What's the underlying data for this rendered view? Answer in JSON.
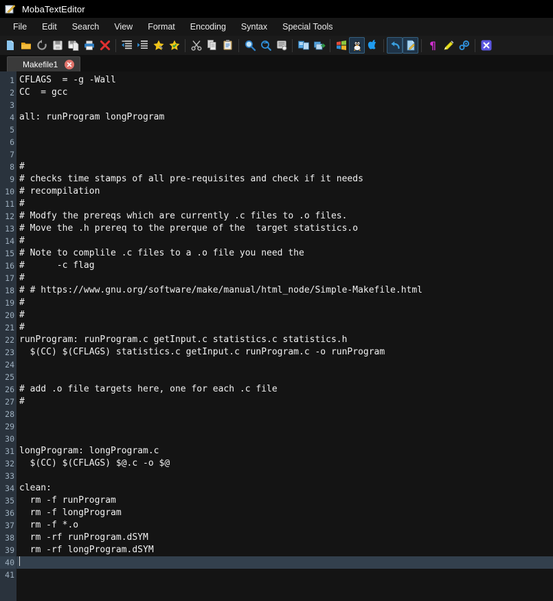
{
  "window": {
    "title": "MobaTextEditor",
    "icon": "notepad-pencil-icon"
  },
  "menubar": {
    "items": [
      {
        "label": "File",
        "name": "menu-file"
      },
      {
        "label": "Edit",
        "name": "menu-edit"
      },
      {
        "label": "Search",
        "name": "menu-search"
      },
      {
        "label": "View",
        "name": "menu-view"
      },
      {
        "label": "Format",
        "name": "menu-format"
      },
      {
        "label": "Encoding",
        "name": "menu-encoding"
      },
      {
        "label": "Syntax",
        "name": "menu-syntax"
      },
      {
        "label": "Special Tools",
        "name": "menu-special-tools"
      }
    ]
  },
  "toolbar": {
    "buttons": [
      {
        "icon": "new-file-icon",
        "title": "New",
        "active": false
      },
      {
        "icon": "open-folder-icon",
        "title": "Open",
        "active": false
      },
      {
        "icon": "reload-icon",
        "title": "Reload",
        "active": false
      },
      {
        "icon": "save-icon",
        "title": "Save",
        "active": false
      },
      {
        "icon": "save-as-icon",
        "title": "Save As",
        "active": false
      },
      {
        "icon": "print-icon",
        "title": "Print",
        "active": false
      },
      {
        "icon": "close-file-icon",
        "title": "Close",
        "active": false
      },
      {
        "icon": "separator",
        "title": "",
        "active": false
      },
      {
        "icon": "unindent-icon",
        "title": "Unindent",
        "active": false
      },
      {
        "icon": "indent-icon",
        "title": "Indent",
        "active": false
      },
      {
        "icon": "bookmark-toggle-icon",
        "title": "Toggle Bookmark",
        "active": false
      },
      {
        "icon": "bookmark-next-icon",
        "title": "Next Bookmark",
        "active": false
      },
      {
        "icon": "separator",
        "title": "",
        "active": false
      },
      {
        "icon": "cut-icon",
        "title": "Cut",
        "active": false
      },
      {
        "icon": "copy-icon",
        "title": "Copy",
        "active": false
      },
      {
        "icon": "paste-icon",
        "title": "Paste",
        "active": false
      },
      {
        "icon": "separator",
        "title": "",
        "active": false
      },
      {
        "icon": "find-icon",
        "title": "Find",
        "active": false
      },
      {
        "icon": "find-replace-icon",
        "title": "Find and Replace",
        "active": false
      },
      {
        "icon": "goto-line-icon",
        "title": "Go To Line",
        "active": false
      },
      {
        "icon": "separator",
        "title": "",
        "active": false
      },
      {
        "icon": "compare-files-icon",
        "title": "Compare",
        "active": false
      },
      {
        "icon": "send-to-icon",
        "title": "Send To",
        "active": false
      },
      {
        "icon": "separator",
        "title": "",
        "active": false
      },
      {
        "icon": "windows-format-icon",
        "title": "Windows Format",
        "active": false
      },
      {
        "icon": "linux-format-icon",
        "title": "Unix Format",
        "active": true
      },
      {
        "icon": "apple-format-icon",
        "title": "Mac Format",
        "active": false
      },
      {
        "icon": "separator",
        "title": "",
        "active": false
      },
      {
        "icon": "undo-icon",
        "title": "Undo",
        "active": true
      },
      {
        "icon": "redo-edit-icon",
        "title": "Redo",
        "active": true
      },
      {
        "icon": "separator",
        "title": "",
        "active": false
      },
      {
        "icon": "pilcrow-icon",
        "title": "Show Formatting",
        "active": false
      },
      {
        "icon": "highlighter-icon",
        "title": "Highlight",
        "active": false
      },
      {
        "icon": "settings-gear-icon",
        "title": "Settings",
        "active": false
      },
      {
        "icon": "separator",
        "title": "",
        "active": false
      },
      {
        "icon": "exit-icon",
        "title": "Exit",
        "active": false
      }
    ]
  },
  "tabs": [
    {
      "label": "Makefile1",
      "close_label": "×",
      "active": true
    }
  ],
  "editor": {
    "current_line": 40,
    "cursor_line": 40,
    "cursor_column": 1,
    "total_lines": 41,
    "colors": {
      "background": "#141414",
      "gutter_background": "#2a333d",
      "gutter_text": "#9fb0bf",
      "text": "#f0f0f0",
      "current_line_highlight": "#33404d"
    },
    "lines": [
      "CFLAGS  = -g -Wall",
      "CC  = gcc",
      "",
      "all: runProgram longProgram",
      "",
      "",
      "",
      "#",
      "# checks time stamps of all pre-requisites and check if it needs",
      "# recompilation",
      "#",
      "# Modfy the prereqs which are currently .c files to .o files.",
      "# Move the .h prereq to the prerque of the  target statistics.o",
      "#",
      "# Note to complile .c files to a .o file you need the",
      "#      -c flag",
      "#",
      "# # https://www.gnu.org/software/make/manual/html_node/Simple-Makefile.html",
      "#",
      "#",
      "#",
      "runProgram: runProgram.c getInput.c statistics.c statistics.h",
      "  $(CC) $(CFLAGS) statistics.c getInput.c runProgram.c -o runProgram",
      "",
      "",
      "# add .o file targets here, one for each .c file",
      "#",
      "",
      "",
      "",
      "longProgram: longProgram.c",
      "  $(CC) $(CFLAGS) $@.c -o $@",
      "",
      "clean:",
      "  rm -f runProgram",
      "  rm -f longProgram",
      "  rm -f *.o",
      "  rm -rf runProgram.dSYM",
      "  rm -rf longProgram.dSYM",
      "",
      ""
    ]
  }
}
